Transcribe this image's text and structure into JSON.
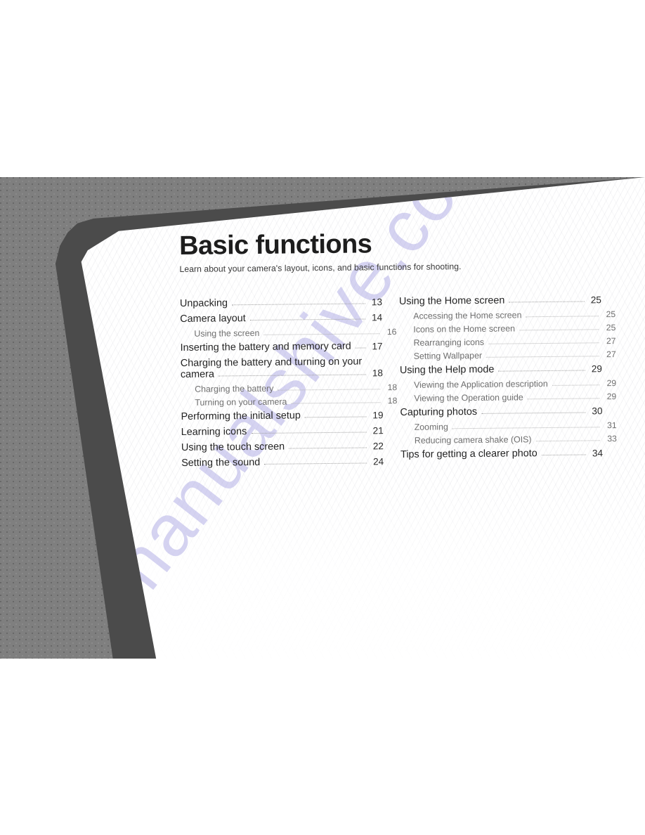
{
  "page": {
    "title": "Basic functions",
    "subtitle": "Learn about your camera's layout, icons, and basic functions for shooting.",
    "watermark": "manualshive.com",
    "background_color": "#7f7f7f",
    "page_color": "#ffffff",
    "shadow_color": "#4b4b4b",
    "watermark_color": "#b3b0e6"
  },
  "toc": {
    "left_column": [
      {
        "label": "Unpacking",
        "page": "13",
        "level": 1
      },
      {
        "label": "Camera layout",
        "page": "14",
        "level": 1
      },
      {
        "label": "Using the screen",
        "page": "16",
        "level": 2
      },
      {
        "label": "Inserting the battery and memory card",
        "page": "17",
        "level": 1
      },
      {
        "label": "Charging the battery and turning on your",
        "label2": "camera",
        "page": "18",
        "level": 1,
        "wrapped": true
      },
      {
        "label": "Charging the battery",
        "page": "18",
        "level": 2
      },
      {
        "label": "Turning on your camera",
        "page": "18",
        "level": 2
      },
      {
        "label": "Performing the initial setup",
        "page": "19",
        "level": 1
      },
      {
        "label": "Learning icons",
        "page": "21",
        "level": 1
      },
      {
        "label": "Using the touch screen",
        "page": "22",
        "level": 1
      },
      {
        "label": "Setting the sound",
        "page": "24",
        "level": 1
      }
    ],
    "right_column": [
      {
        "label": "Using the Home screen",
        "page": "25",
        "level": 1
      },
      {
        "label": "Accessing the Home screen",
        "page": "25",
        "level": 2
      },
      {
        "label": "Icons on the Home screen",
        "page": "25",
        "level": 2
      },
      {
        "label": "Rearranging icons",
        "page": "27",
        "level": 2
      },
      {
        "label": "Setting Wallpaper",
        "page": "27",
        "level": 2
      },
      {
        "label": "Using the Help mode",
        "page": "29",
        "level": 1
      },
      {
        "label": "Viewing the Application description",
        "page": "29",
        "level": 2
      },
      {
        "label": "Viewing the Operation guide",
        "page": "29",
        "level": 2
      },
      {
        "label": "Capturing photos",
        "page": "30",
        "level": 1
      },
      {
        "label": "Zooming",
        "page": "31",
        "level": 2
      },
      {
        "label": "Reducing camera shake (OIS)",
        "page": "33",
        "level": 2
      },
      {
        "label": "Tips for getting a clearer photo",
        "page": "34",
        "level": 1
      }
    ]
  }
}
